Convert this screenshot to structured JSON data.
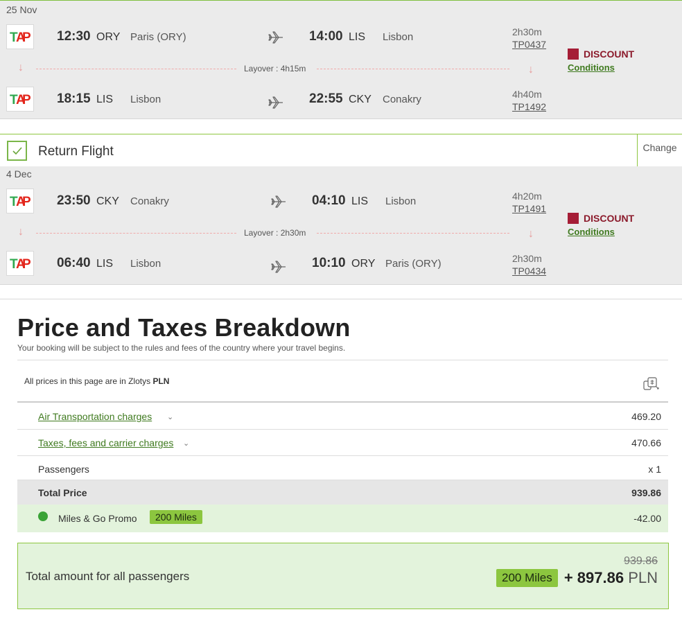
{
  "outbound": {
    "date": "25 Nov",
    "segments": [
      {
        "dep_time": "12:30",
        "dep_code": "ORY",
        "dep_city": "Paris (ORY)",
        "arr_time": "14:00",
        "arr_code": "LIS",
        "arr_city": "Lisbon",
        "duration": "2h30m",
        "flight_no": "TP0437"
      },
      {
        "dep_time": "18:15",
        "dep_code": "LIS",
        "dep_city": "Lisbon",
        "arr_time": "22:55",
        "arr_code": "CKY",
        "arr_city": "Conakry",
        "duration": "4h40m",
        "flight_no": "TP1492"
      }
    ],
    "layover": "Layover : 4h15m",
    "fare": "DISCOUNT",
    "conditions": "Conditions"
  },
  "return_header": {
    "title": "Return Flight",
    "change": "Change"
  },
  "return": {
    "date": "4 Dec",
    "segments": [
      {
        "dep_time": "23:50",
        "dep_code": "CKY",
        "dep_city": "Conakry",
        "arr_time": "04:10",
        "arr_code": "LIS",
        "arr_city": "Lisbon",
        "duration": "4h20m",
        "flight_no": "TP1491"
      },
      {
        "dep_time": "06:40",
        "dep_code": "LIS",
        "dep_city": "Lisbon",
        "arr_time": "10:10",
        "arr_code": "ORY",
        "arr_city": "Paris (ORY)",
        "duration": "2h30m",
        "flight_no": "TP0434"
      }
    ],
    "layover": "Layover : 2h30m",
    "fare": "DISCOUNT",
    "conditions": "Conditions"
  },
  "price": {
    "title": "Price and Taxes Breakdown",
    "subtitle": "Your booking will be subject to the rules and fees of the country where your travel begins.",
    "currency_prefix": "All prices in this page are in Zlotys",
    "currency_code": "PLN",
    "rows": {
      "air_label": "Air Transportation charges",
      "air_value": "469.20",
      "tax_label": "Taxes, fees and carrier charges",
      "tax_value": "470.66",
      "pax_label": "Passengers",
      "pax_value": "x 1",
      "total_label": "Total Price",
      "total_value": "939.86",
      "promo_label": "Miles & Go Promo",
      "promo_badge": "200 Miles",
      "promo_value": "-42.00"
    },
    "grand": {
      "label": "Total amount for all passengers",
      "old_price": "939.86",
      "badge": "200 Miles",
      "amount": "+ 897.86",
      "currency": "PLN"
    }
  },
  "colors": {
    "accent_green": "#8dc63f",
    "link_green": "#3f7a1f",
    "discount_red": "#a51d36"
  },
  "icons": [
    "tap-logo-icon",
    "plane-icon",
    "down-arrow-icon",
    "checkmark-icon",
    "currency-exchange-icon",
    "miles-promo-icon",
    "chevron-down-icon"
  ]
}
